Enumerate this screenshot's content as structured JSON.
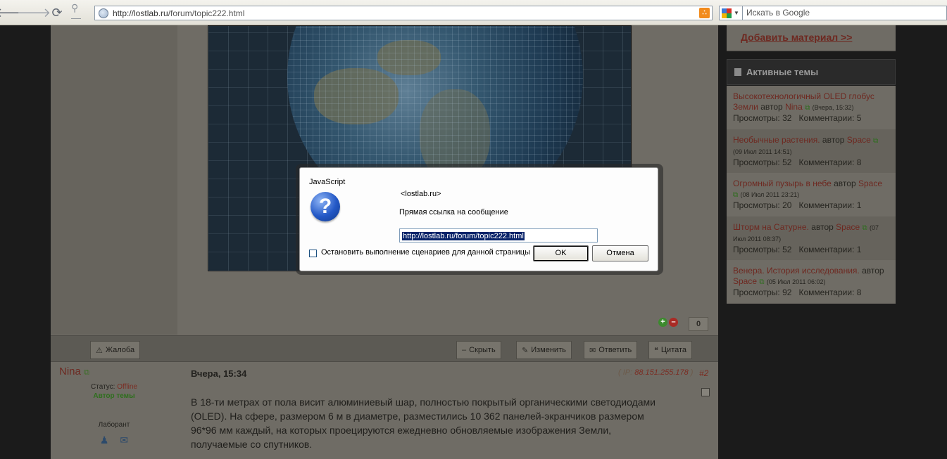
{
  "browser": {
    "url_host": "http://lostlab.ru",
    "url_path": "/forum/topic222.html",
    "search_placeholder": "Искать в Google"
  },
  "sidebar": {
    "add_material": "Добавить материал >>",
    "active_topics_title": "Активные темы",
    "topics": [
      {
        "title": "Высокотехнологичный OLED глобус Земли",
        "by": "автор",
        "author": "Nina",
        "date": "(Вчера, 15:32)",
        "views_label": "Просмотры:",
        "views": "32",
        "comments_label": "Комментарии:",
        "comments": "5"
      },
      {
        "title": "Необычные растения.",
        "by": "автор",
        "author": "Space",
        "date": "(09 Июл 2011 14:51)",
        "views_label": "Просмотры:",
        "views": "52",
        "comments_label": "Комментарии:",
        "comments": "8"
      },
      {
        "title": "Огромный пузырь в небе",
        "by": "автор",
        "author": "Space",
        "date": "(08 Июл 2011 23:21)",
        "views_label": "Просмотры:",
        "views": "20",
        "comments_label": "Комментарии:",
        "comments": "1"
      },
      {
        "title": "Шторм на Сатурне.",
        "by": "автор",
        "author": "Space",
        "date": "(07 Июл 2011 08:37)",
        "views_label": "Просмотры:",
        "views": "52",
        "comments_label": "Комментарии:",
        "comments": "1"
      },
      {
        "title": "Венера. История исследования.",
        "by": "автор",
        "author": "Space",
        "date": "(05 Июл 2011 06:02)",
        "views_label": "Просмотры:",
        "views": "92",
        "comments_label": "Комментарии:",
        "comments": "8"
      }
    ]
  },
  "post_actions": {
    "vote_count": "0",
    "complain": "Жалоба",
    "hide": "Скрыть",
    "edit": "Изменить",
    "reply": "Ответить",
    "quote": "Цитата"
  },
  "post": {
    "author": "Nina",
    "time": "Вчера, 15:34",
    "ip_label": "IP:",
    "ip": "88.151.255.178",
    "number": "#2",
    "status_label": "Статус:",
    "status_value": "Offline",
    "topic_author": "Автор темы",
    "rank": "Лаборант",
    "body": "В 18-ти метрах от пола висит алюминиевый шар, полностью покрытый органическими светодиодами (OLED). На сфере, размером 6 м в диаметре, разместились 10 362 панелей-экранчиков размером 96*96 мм каждый, на которых проецируются ежедневно обновляемые изображения Земли, получаемые со спутников."
  },
  "dialog": {
    "title": "JavaScript",
    "site": "<lostlab.ru>",
    "message": "Прямая ссылка на сообщение",
    "input_value": "http://lostlab.ru/forum/topic222.html",
    "checkbox_label": "Остановить выполнение сценариев для данной страницы",
    "ok": "OK",
    "cancel": "Отмена"
  }
}
